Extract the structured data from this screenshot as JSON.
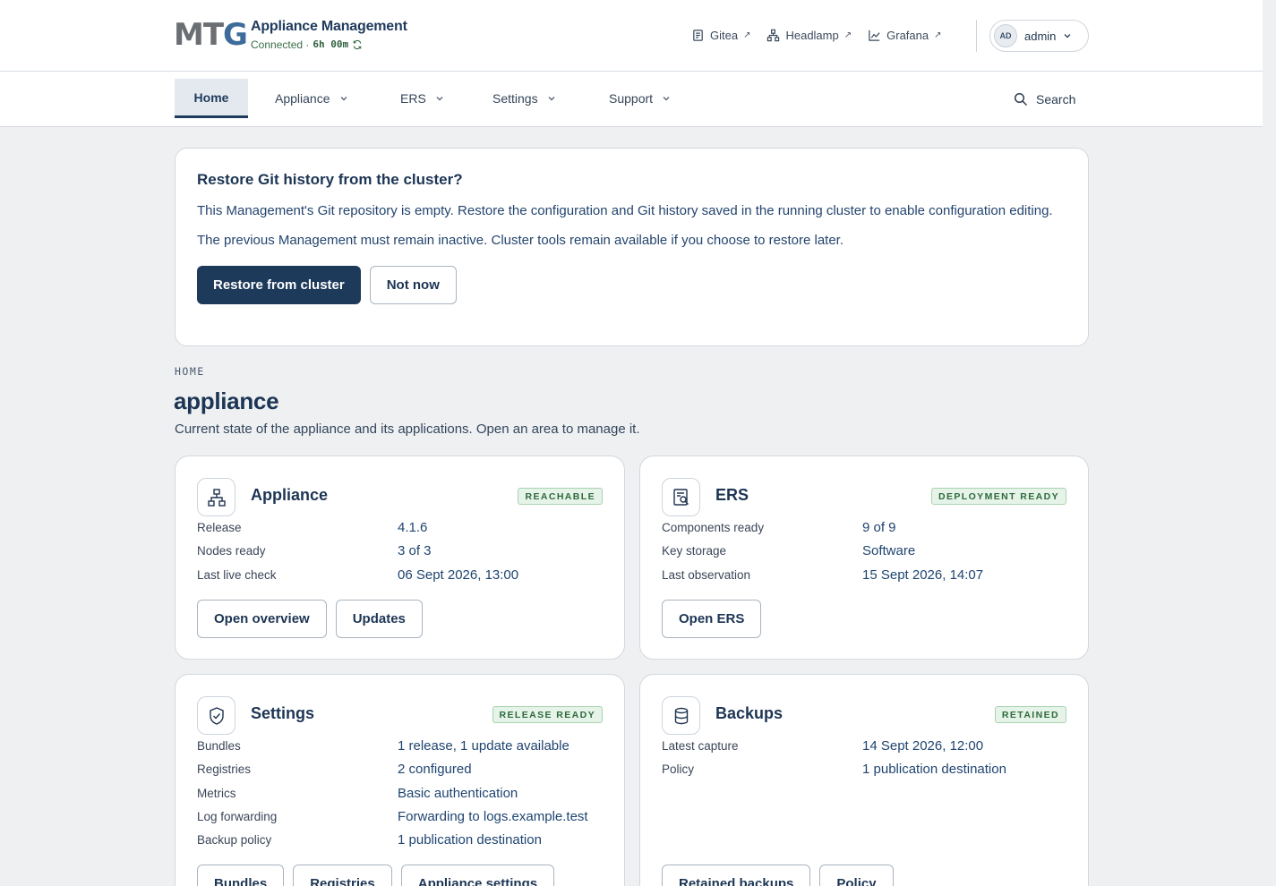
{
  "header": {
    "logo": "MTG",
    "app_title": "Appliance Management",
    "status_label": "Connected ·",
    "uptime": "6h 00m",
    "links": [
      {
        "label": "Gitea",
        "icon": "document-icon"
      },
      {
        "label": "Headlamp",
        "icon": "network-icon"
      },
      {
        "label": "Grafana",
        "icon": "chart-icon"
      }
    ],
    "user": {
      "initials": "AD",
      "name": "admin"
    }
  },
  "nav": {
    "items": [
      {
        "label": "Home",
        "active": true
      },
      {
        "label": "Appliance"
      },
      {
        "label": "ERS"
      },
      {
        "label": "Settings"
      },
      {
        "label": "Support"
      }
    ],
    "search_label": "Search"
  },
  "banner": {
    "title": "Restore Git history from the cluster?",
    "text1": "This Management's Git repository is empty. Restore the configuration and Git history saved in the running cluster to enable configuration editing.",
    "text2": "The previous Management must remain inactive. Cluster tools remain available if you choose to restore later.",
    "primary_button": "Restore from cluster",
    "secondary_button": "Not now"
  },
  "page": {
    "eyebrow": "HOME",
    "title": "appliance",
    "subtitle": "Current state of the appliance and its applications. Open an area to manage it."
  },
  "cards": {
    "appliance": {
      "title": "Appliance",
      "badge": "REACHABLE",
      "rows": [
        {
          "key": "Release",
          "value": "4.1.6"
        },
        {
          "key": "Nodes ready",
          "value": "3 of 3"
        },
        {
          "key": "Last live check",
          "value": "06 Sept 2026, 13:00"
        }
      ],
      "buttons": [
        "Open overview",
        "Updates"
      ]
    },
    "ers": {
      "title": "ERS",
      "badge": "DEPLOYMENT READY",
      "rows": [
        {
          "key": "Components ready",
          "value": "9 of 9"
        },
        {
          "key": "Key storage",
          "value": "Software"
        },
        {
          "key": "Last observation",
          "value": "15 Sept 2026, 14:07"
        }
      ],
      "buttons": [
        "Open ERS"
      ]
    },
    "settings": {
      "title": "Settings",
      "badge": "RELEASE READY",
      "rows": [
        {
          "key": "Bundles",
          "value": "1 release, 1 update available"
        },
        {
          "key": "Registries",
          "value": "2 configured"
        },
        {
          "key": "Metrics",
          "value": "Basic authentication"
        },
        {
          "key": "Log forwarding",
          "value": "Forwarding to logs.example.test"
        },
        {
          "key": "Backup policy",
          "value": "1 publication destination"
        }
      ],
      "buttons": [
        "Bundles",
        "Registries",
        "Appliance settings"
      ]
    },
    "backups": {
      "title": "Backups",
      "badge": "RETAINED",
      "rows": [
        {
          "key": "Latest capture",
          "value": "14 Sept 2026, 12:00"
        },
        {
          "key": "Policy",
          "value": "1 publication destination"
        }
      ],
      "buttons": [
        "Retained backups",
        "Policy"
      ]
    }
  },
  "colors": {
    "primary": "#1d3a5b",
    "badge_bg": "#e6f3e8",
    "badge_text": "#2e6a3d",
    "page_bg": "#eef0f2"
  }
}
